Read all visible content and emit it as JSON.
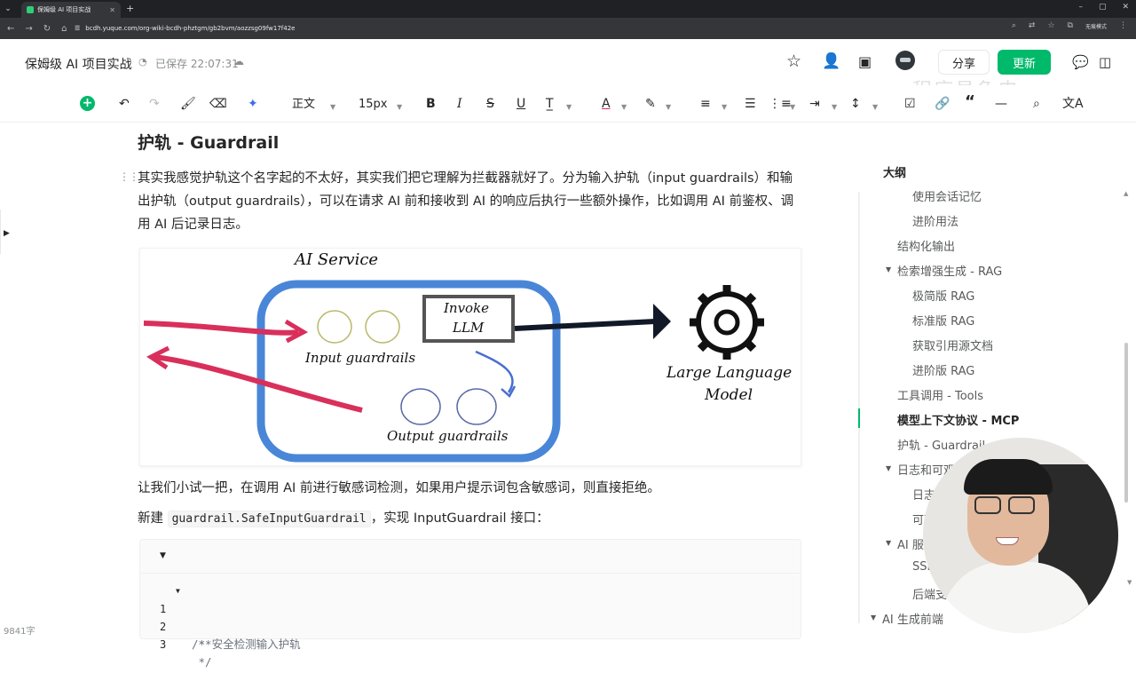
{
  "browser": {
    "tab_title": "保姆级 AI 项目实战",
    "url": "bcdh.yuque.com/org-wiki-bcdh-phztgm/gb2bvm/aozzsg09fw17f42e",
    "profile_label": "无痕模式"
  },
  "header": {
    "doc_title": "保姆级 AI 项目实战",
    "save_status": "已保存 22:07:31",
    "share_label": "分享",
    "update_label": "更新",
    "watermark": "程序员鱼皮"
  },
  "toolbar": {
    "paragraph_style": "正文",
    "font_size": "15px"
  },
  "content": {
    "heading": "护轨 - Guardrail",
    "paragraph1": "其实我感觉护轨这个名字起的不太好，其实我们把它理解为拦截器就好了。分为输入护轨（input guardrails）和输出护轨（output guardrails），可以在请求 AI 前和接收到 AI 的响应后执行一些额外操作，比如调用 AI 前鉴权、调用 AI 后记录日志。",
    "paragraph2": "让我们小试一把，在调用 AI 前进行敏感词检测，如果用户提示词包含敏感词，则直接拒绝。",
    "paragraph3_prefix": "新建 ",
    "paragraph3_code": "guardrail.SafeInputGuardrail",
    "paragraph3_suffix": "，实现 InputGuardrail 接口：",
    "figure": {
      "service_label": "AI Service",
      "invoke_label_1": "Invoke",
      "invoke_label_2": "LLM",
      "input_label": "Input guardrails",
      "output_label": "Output guardrails",
      "llm_label_1": "Large Language",
      "llm_label_2": "Model"
    },
    "code_lines": [
      {
        "num": "1",
        "text": "/**"
      },
      {
        "num": "2",
        "text": " * 安全检测输入护轨"
      },
      {
        "num": "3",
        "text": " */"
      }
    ],
    "word_count": "9841字"
  },
  "outline": {
    "title": "大纲",
    "items": [
      {
        "label": "使用会话记忆"
      },
      {
        "label": "进阶用法"
      },
      {
        "label": "结构化输出"
      },
      {
        "label": "检索增强生成 - RAG"
      },
      {
        "label": "极简版 RAG"
      },
      {
        "label": "标准版 RAG"
      },
      {
        "label": "获取引用源文档"
      },
      {
        "label": "进阶版 RAG"
      },
      {
        "label": "工具调用 - Tools"
      },
      {
        "label": "模型上下文协议 - MCP"
      },
      {
        "label": "护轨 - Guardrail"
      },
      {
        "label": "日志和可观测性"
      },
      {
        "label": "日志"
      },
      {
        "label": "可观测性"
      },
      {
        "label": "AI 服务化"
      },
      {
        "label": "SSE"
      },
      {
        "label": "后端支持"
      },
      {
        "label": "AI 生成前端"
      }
    ]
  },
  "colors": {
    "brand_green": "#00b96b",
    "arrow_red": "#d92f5b",
    "service_blue": "#4a86d8"
  }
}
